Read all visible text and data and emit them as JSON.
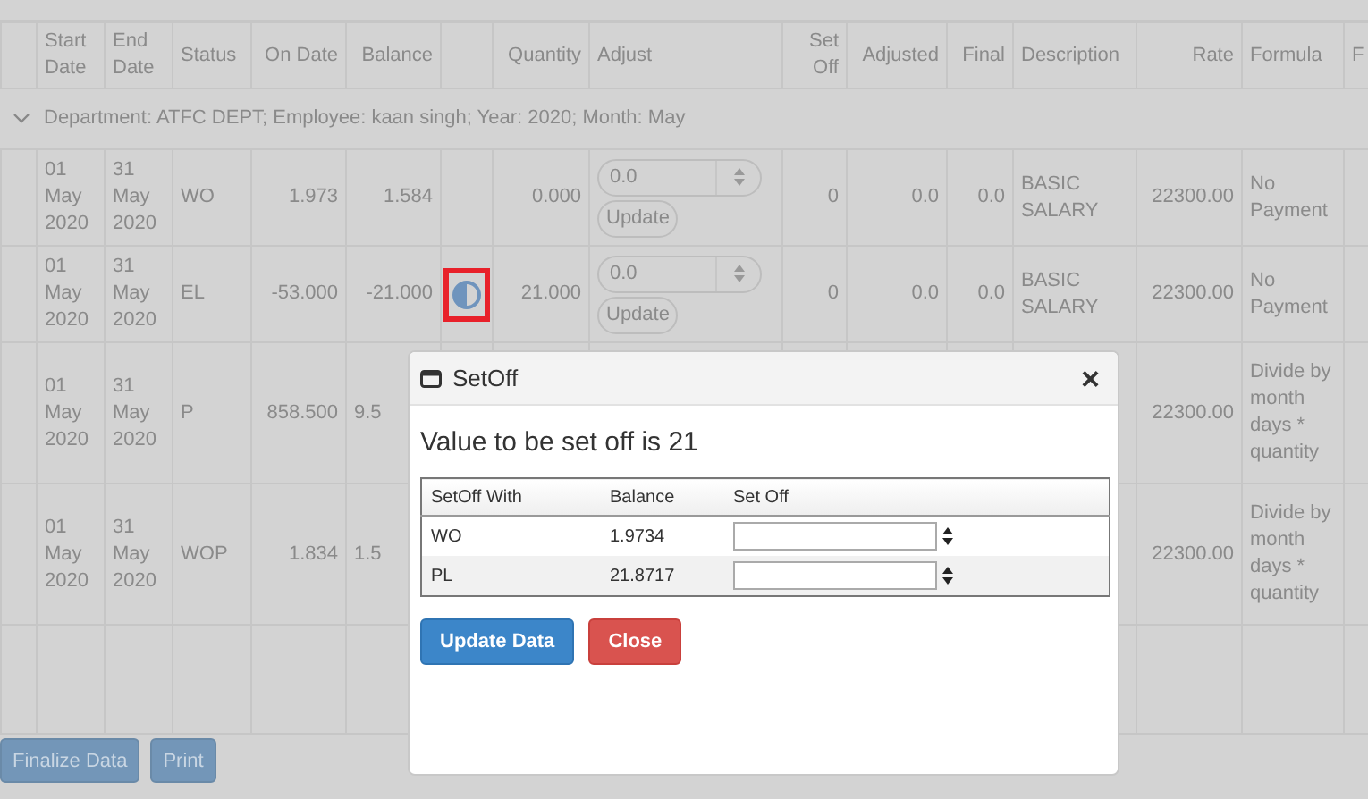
{
  "table": {
    "columns": [
      "",
      "Start Date",
      "End Date",
      "Status",
      "On Date",
      "Balance",
      "",
      "Quantity",
      "Adjust",
      "Set Off",
      "Adjusted",
      "Final",
      "Description",
      "Rate",
      "Formula",
      "F"
    ],
    "group": {
      "label": "Department: ATFC DEPT; Employee: kaan singh; Year: 2020; Month: May",
      "expanded": true
    },
    "rows": [
      {
        "start": "01 May 2020",
        "end": "31 May 2020",
        "status": "WO",
        "on_date": "1.973",
        "balance": "1.584",
        "kind": "plain",
        "quantity": "0.000",
        "adjust": "0.0",
        "update": "Update",
        "set_off": "0",
        "adjusted": "0.0",
        "final": "0.0",
        "description": "BASIC SALARY",
        "rate": "22300.00",
        "formula": "No Payment"
      },
      {
        "start": "01 May 2020",
        "end": "31 May 2020",
        "status": "EL",
        "on_date": "-53.000",
        "balance": "-21.000",
        "kind": "setoff",
        "highlighted": true,
        "quantity": "21.000",
        "adjust": "0.0",
        "update": "Update",
        "set_off": "0",
        "adjusted": "0.0",
        "final": "0.0",
        "description": "BASIC SALARY",
        "rate": "22300.00",
        "formula": "No Payment"
      },
      {
        "start": "01 May 2020",
        "end": "31 May 2020",
        "status": "P",
        "on_date": "858.500",
        "balance": "9.5",
        "kind": "plain",
        "rate": "22300.00",
        "formula": "Divide by month days * quantity"
      },
      {
        "start": "01 May 2020",
        "end": "31 May 2020",
        "status": "WOP",
        "on_date": "1.834",
        "balance": "1.5",
        "kind": "plain",
        "rate": "22300.00",
        "formula": "Divide by month days * quantity"
      }
    ]
  },
  "buttons": [
    "Finalize Data",
    "Print"
  ],
  "dialog": {
    "title": "SetOff",
    "close": "×",
    "message": "Value to be set off is 21",
    "columns": [
      "SetOff With",
      "Balance",
      "Set Off"
    ],
    "rows": [
      {
        "with": "WO",
        "balance": "1.9734"
      },
      {
        "with": "PL",
        "balance": "21.8717"
      }
    ],
    "buttons": [
      {
        "label": "Update Data",
        "kind": "primary"
      },
      {
        "label": "Close",
        "kind": "danger"
      }
    ]
  }
}
